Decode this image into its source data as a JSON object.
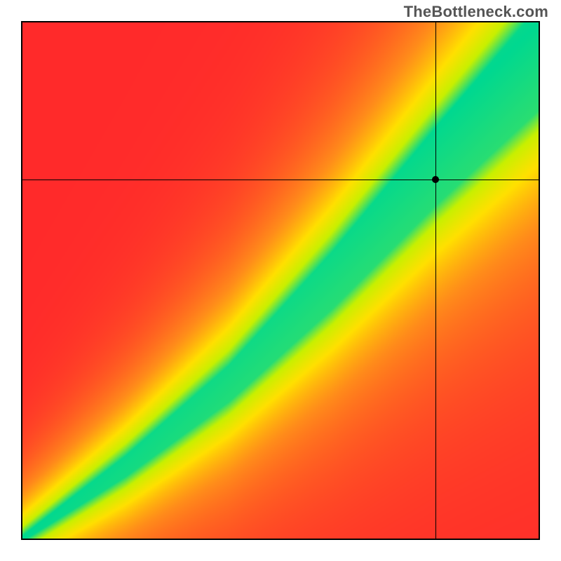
{
  "watermark": "TheBottleneck.com",
  "chart_data": {
    "type": "heatmap",
    "title": "",
    "xlabel": "",
    "ylabel": "",
    "xlim": [
      0,
      1
    ],
    "ylim": [
      0,
      1
    ],
    "grid": false,
    "legend": false,
    "crosshair": {
      "x": 0.8,
      "y": 0.695
    },
    "marker": {
      "x": 0.8,
      "y": 0.695
    },
    "color_stops": [
      {
        "value": 0.0,
        "color": "#ff2a2a"
      },
      {
        "value": 0.35,
        "color": "#ff8c1a"
      },
      {
        "value": 0.6,
        "color": "#ffe000"
      },
      {
        "value": 0.8,
        "color": "#c8f000"
      },
      {
        "value": 1.0,
        "color": "#00d890"
      }
    ],
    "optimal_band": {
      "description": "Green diagonal sweet-spot band where x and y are balanced; band widens toward the upper-right.",
      "center_curve_points": [
        {
          "x": 0.0,
          "y": 0.0
        },
        {
          "x": 0.2,
          "y": 0.14
        },
        {
          "x": 0.4,
          "y": 0.3
        },
        {
          "x": 0.6,
          "y": 0.5
        },
        {
          "x": 0.8,
          "y": 0.72
        },
        {
          "x": 1.0,
          "y": 0.93
        }
      ],
      "half_width_at_x": [
        {
          "x": 0.0,
          "half_width": 0.005
        },
        {
          "x": 0.2,
          "half_width": 0.02
        },
        {
          "x": 0.4,
          "half_width": 0.035
        },
        {
          "x": 0.6,
          "half_width": 0.055
        },
        {
          "x": 0.8,
          "half_width": 0.075
        },
        {
          "x": 1.0,
          "half_width": 0.1
        }
      ]
    }
  }
}
